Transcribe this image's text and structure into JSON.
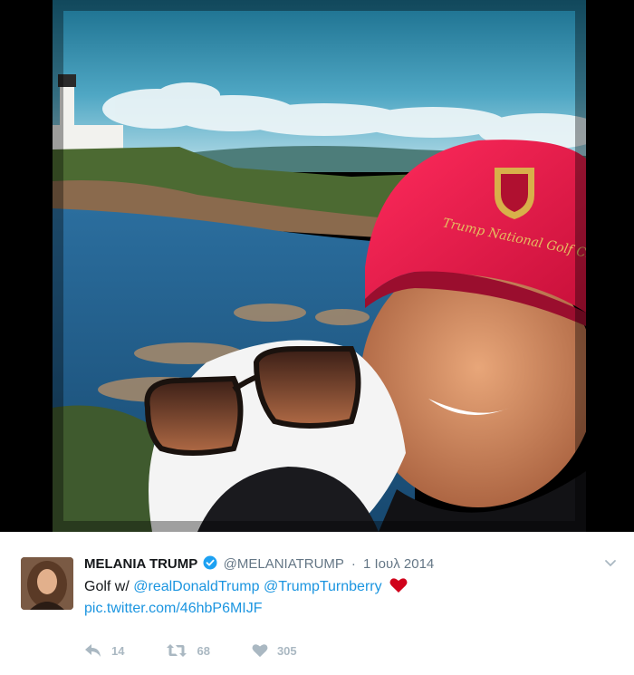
{
  "tweet": {
    "author_name": "MELANIA TRUMP",
    "handle": "@MELANIATRUMP",
    "separator": "·",
    "date": "1 Ιουλ 2014",
    "text_prefix": "Golf w/",
    "mention_1": "@realDonaldTrump",
    "mention_2": "@TrumpTurnberry",
    "pic_link": "pic.twitter.com/46hbP6MIJF"
  },
  "actions": {
    "replies": "14",
    "retweets": "68",
    "likes": "305"
  },
  "icons": {
    "verified": "verified-badge-icon",
    "caret": "chevron-down-icon",
    "reply": "reply-icon",
    "retweet": "retweet-icon",
    "like": "heart-icon",
    "emoji": "red-heart-icon"
  },
  "colors": {
    "link": "#1b95e0",
    "verified": "#1da1f2",
    "action_gray": "#aab8c2",
    "heart_emoji": "#d0021b"
  }
}
